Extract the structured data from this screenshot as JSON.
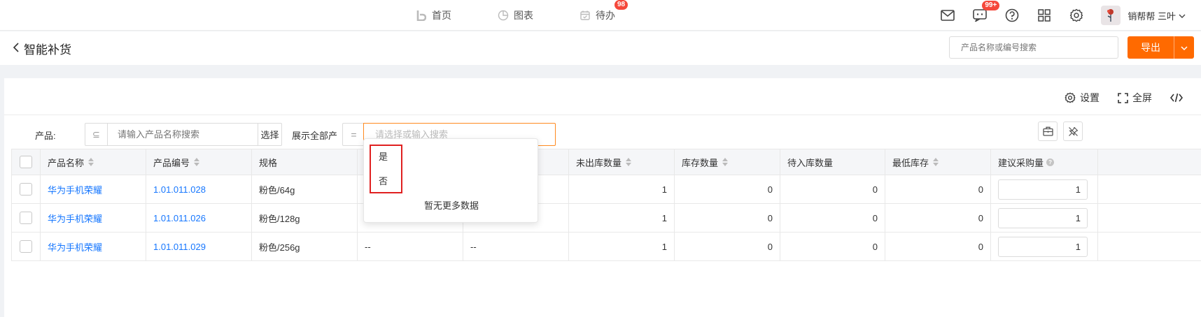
{
  "nav": {
    "items": [
      {
        "label": "首页",
        "icon": "logo-b-icon"
      },
      {
        "label": "图表",
        "icon": "pie-chart-icon"
      },
      {
        "label": "待办",
        "icon": "calendar-icon",
        "badge": "98"
      }
    ],
    "message_badge": "99+",
    "user_name": "销帮帮 三叶"
  },
  "header": {
    "title": "智能补货",
    "search_placeholder": "产品名称或编号搜索",
    "export_label": "导出"
  },
  "toolbar": {
    "settings_label": "设置",
    "fullscreen_label": "全屏"
  },
  "filters": {
    "product_label": "产品:",
    "product_prefix": "⊆",
    "product_placeholder": "请输入产品名称搜索",
    "select_label": "选择",
    "show_all_label": "展示全部产",
    "eq_symbol": "=",
    "show_all_placeholder": "请选择或输入搜索"
  },
  "dropdown": {
    "options": [
      "是",
      "否"
    ],
    "empty_text": "暂无更多数据"
  },
  "table": {
    "columns": [
      "产品名称",
      "产品编号",
      "规格",
      "",
      "",
      "未出库数量",
      "库存数量",
      "待入库数量",
      "最低库存",
      "建议采购量"
    ],
    "rows": [
      {
        "name": "华为手机荣耀",
        "code": "1.01.011.028",
        "spec": "粉色/64g",
        "c4": "",
        "c5": "",
        "unshipped": "1",
        "stock": "0",
        "incoming": "0",
        "min_stock": "0",
        "suggested": "1"
      },
      {
        "name": "华为手机荣耀",
        "code": "1.01.011.026",
        "spec": "粉色/128g",
        "c4": "",
        "c5": "",
        "unshipped": "1",
        "stock": "0",
        "incoming": "0",
        "min_stock": "0",
        "suggested": "1"
      },
      {
        "name": "华为手机荣耀",
        "code": "1.01.011.029",
        "spec": "粉色/256g",
        "c4": "--",
        "c5": "--",
        "unshipped": "1",
        "stock": "0",
        "incoming": "0",
        "min_stock": "0",
        "suggested": "1"
      }
    ]
  },
  "colors": {
    "accent": "#ff6a00",
    "link": "#1677ff",
    "badge": "#f5483b",
    "highlight_border": "#e02020"
  }
}
